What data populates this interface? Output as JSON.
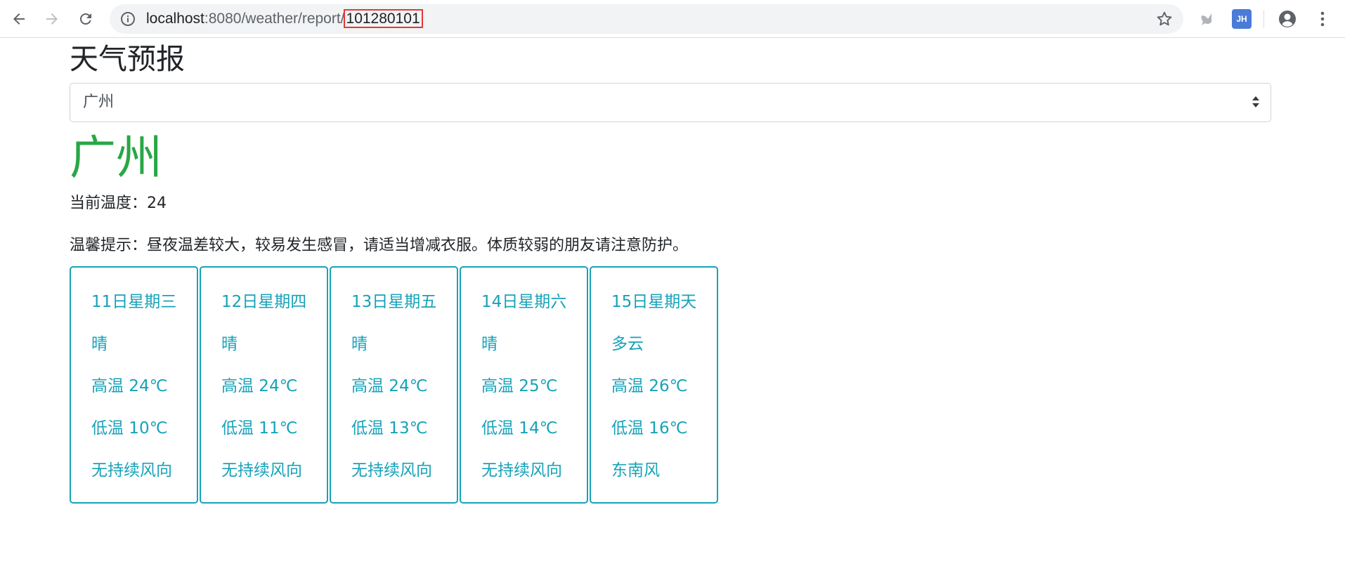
{
  "browser": {
    "url_host": "localhost",
    "url_port_path": ":8080/weather/report/",
    "url_id": "101280101",
    "profile_ext_label": "JH"
  },
  "page": {
    "title": "天气预报",
    "select_value": "广州",
    "city": "广州",
    "current_temp": "当前温度：24",
    "tip": "温馨提示：昼夜温差较大，较易发生感冒，请适当增减衣服。体质较弱的朋友请注意防护。"
  },
  "forecast": [
    {
      "date": "11日星期三",
      "weather": "晴",
      "high": "高温 24℃",
      "low": "低温 10℃",
      "wind": "无持续风向"
    },
    {
      "date": "12日星期四",
      "weather": "晴",
      "high": "高温 24℃",
      "low": "低温 11℃",
      "wind": "无持续风向"
    },
    {
      "date": "13日星期五",
      "weather": "晴",
      "high": "高温 24℃",
      "low": "低温 13℃",
      "wind": "无持续风向"
    },
    {
      "date": "14日星期六",
      "weather": "晴",
      "high": "高温 25℃",
      "low": "低温 14℃",
      "wind": "无持续风向"
    },
    {
      "date": "15日星期天",
      "weather": "多云",
      "high": "高温 26℃",
      "low": "低温 16℃",
      "wind": "东南风"
    }
  ],
  "colors": {
    "city": "#28a745",
    "card_accent": "#17a2b8",
    "url_highlight_border": "#e53935"
  }
}
